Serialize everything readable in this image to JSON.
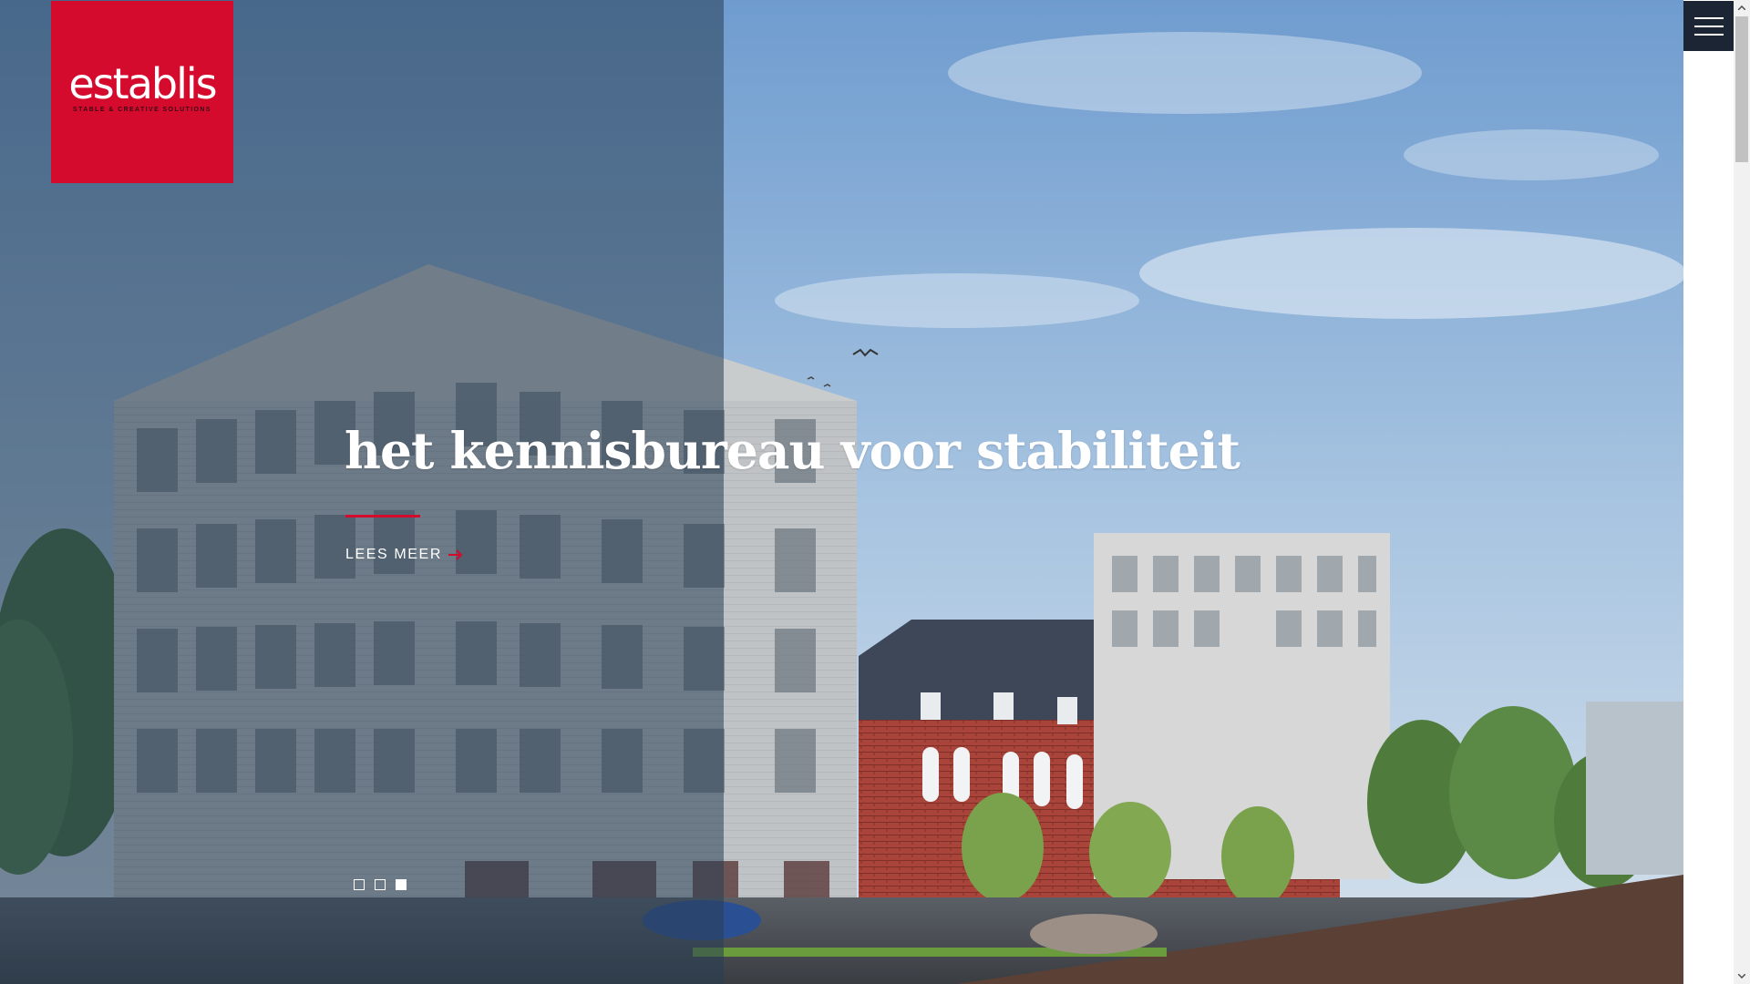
{
  "brand": {
    "name": "establis",
    "tagline": "STABLE & CREATIVE SOLUTIONS",
    "color": "#d50b2e"
  },
  "hero": {
    "headline": "het kennisbureau voor stabiliteit",
    "cta_label": "LEES MEER",
    "cta_icon": "arrow-right-icon",
    "overlay_color": "#283e54"
  },
  "slider": {
    "slide_count": 3,
    "active_slide": 3
  },
  "menu": {
    "icon": "hamburger-menu-icon",
    "background": "#1b2533"
  },
  "scrollbar": {
    "up_icon": "chevron-up-icon",
    "down_icon": "chevron-down-icon"
  }
}
